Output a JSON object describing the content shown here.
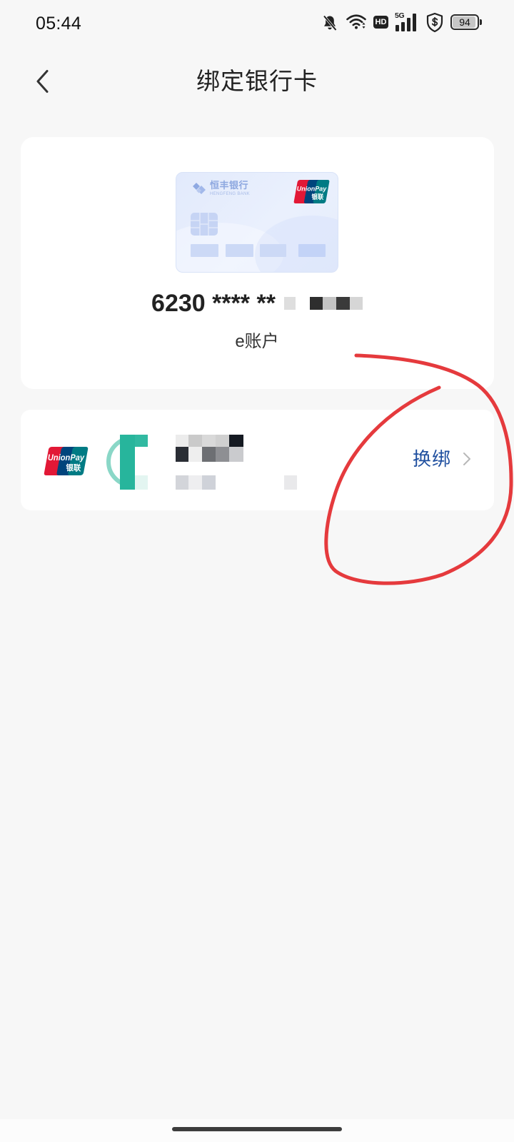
{
  "status_bar": {
    "time": "05:44",
    "icons": [
      "bell-muted-icon",
      "wifi-icon",
      "hd-icon",
      "5g-signal-icon",
      "shield-dollar-icon",
      "battery-icon"
    ],
    "hd_label": "HD",
    "network_label": "5G",
    "battery_level": "94"
  },
  "header": {
    "back_icon": "chevron-left-icon",
    "title": "绑定银行卡"
  },
  "account_card": {
    "bank_logo_icon": "hengfeng-bank-logo-icon",
    "bank_name": "恒丰银行",
    "bank_name_en": "HENGFENG BANK",
    "network_logo": {
      "en": "UnionPay",
      "zh": "银联"
    },
    "card_number_masked": "6230 **** **",
    "account_type": "e账户"
  },
  "linked_card": {
    "network_logo": {
      "en": "UnionPay",
      "zh": "银联"
    },
    "bank_logo_icon": "bank-logo-icon",
    "rebind_label": "换绑",
    "chevron_icon": "chevron-right-icon"
  },
  "colors": {
    "background": "#f7f7f7",
    "panel": "#ffffff",
    "link": "#1f4f9f",
    "annotation": "#e53a3d",
    "unionpay_red": "#e21836",
    "unionpay_blue": "#00447c",
    "unionpay_teal": "#007b84",
    "card_tint": "#e4ecfc"
  }
}
